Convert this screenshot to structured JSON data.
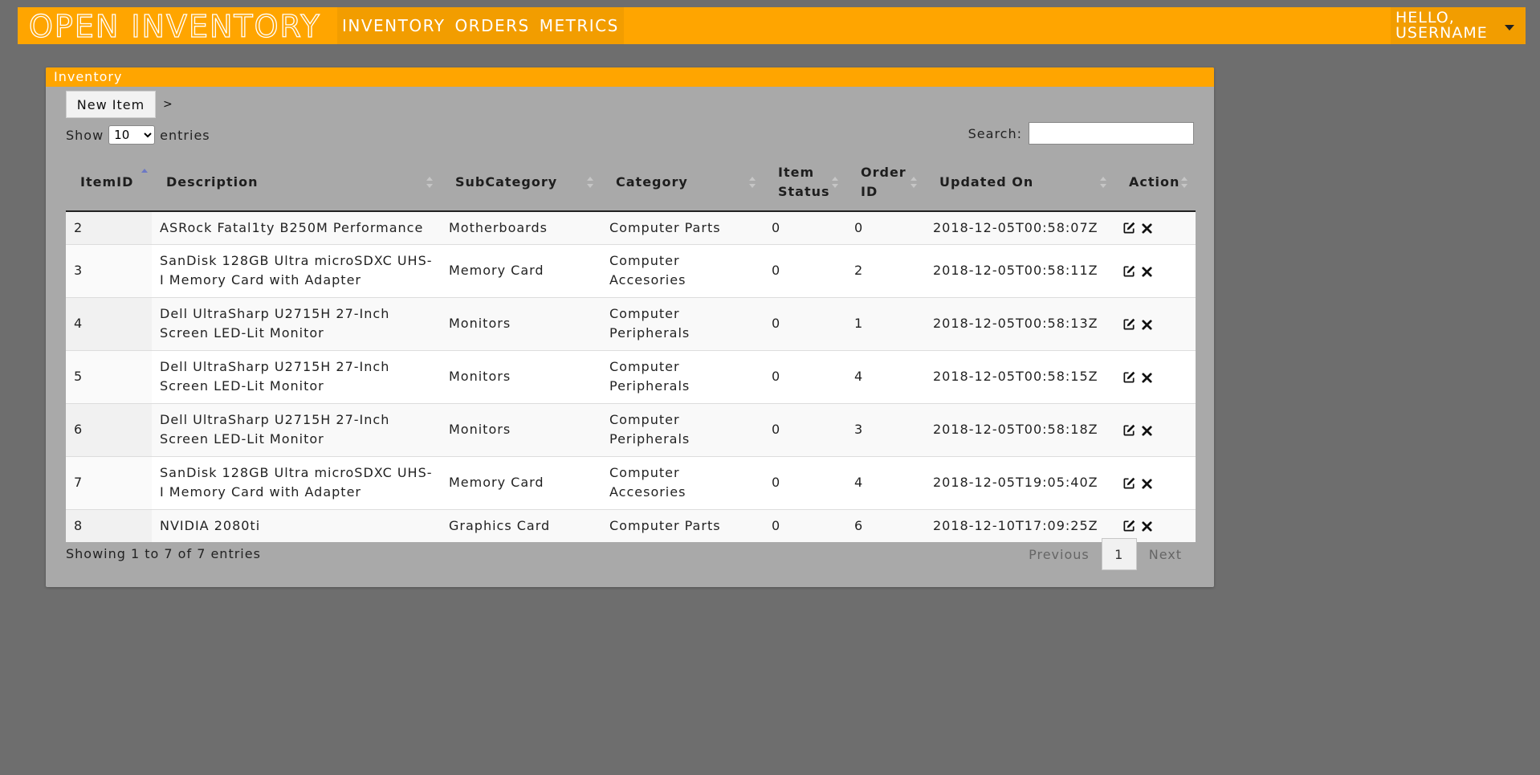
{
  "app": {
    "brand": "OPEN INVENTORY"
  },
  "nav": {
    "links": [
      "INVENTORY",
      "ORDERS",
      "METRICS"
    ]
  },
  "user": {
    "greeting": "HELLO, USERNAME"
  },
  "panel": {
    "title": "Inventory",
    "new_item_label": "New Item",
    "breadcrumb": ">",
    "length": {
      "prefix": "Show",
      "value": "10",
      "suffix": "entries",
      "options": [
        "10"
      ]
    },
    "search": {
      "label": "Search:",
      "value": ""
    }
  },
  "table": {
    "columns": [
      "ItemID",
      "Description",
      "SubCategory",
      "Category",
      "Item Status",
      "Order ID",
      "Updated On",
      "Action"
    ],
    "sort": {
      "column": "ItemID",
      "direction": "asc"
    },
    "rows": [
      {
        "id": "2",
        "description": "ASRock Fatal1ty B250M Performance",
        "subcategory": "Motherboards",
        "category": "Computer Parts",
        "status": "0",
        "order": "0",
        "updated": "2018-12-05T00:58:07Z"
      },
      {
        "id": "3",
        "description": "SanDisk 128GB Ultra microSDXC UHS-I Memory Card with Adapter",
        "subcategory": "Memory Card",
        "category": "Computer Accesories",
        "status": "0",
        "order": "2",
        "updated": "2018-12-05T00:58:11Z"
      },
      {
        "id": "4",
        "description": "Dell UltraSharp U2715H 27-Inch Screen LED-Lit Monitor",
        "subcategory": "Monitors",
        "category": "Computer Peripherals",
        "status": "0",
        "order": "1",
        "updated": "2018-12-05T00:58:13Z"
      },
      {
        "id": "5",
        "description": "Dell UltraSharp U2715H 27-Inch Screen LED-Lit Monitor",
        "subcategory": "Monitors",
        "category": "Computer Peripherals",
        "status": "0",
        "order": "4",
        "updated": "2018-12-05T00:58:15Z"
      },
      {
        "id": "6",
        "description": "Dell UltraSharp U2715H 27-Inch Screen LED-Lit Monitor",
        "subcategory": "Monitors",
        "category": "Computer Peripherals",
        "status": "0",
        "order": "3",
        "updated": "2018-12-05T00:58:18Z"
      },
      {
        "id": "7",
        "description": "SanDisk 128GB Ultra microSDXC UHS-I Memory Card with Adapter",
        "subcategory": "Memory Card",
        "category": "Computer Accesories",
        "status": "0",
        "order": "4",
        "updated": "2018-12-05T19:05:40Z"
      },
      {
        "id": "8",
        "description": "NVIDIA 2080ti",
        "subcategory": "Graphics Card",
        "category": "Computer Parts",
        "status": "0",
        "order": "6",
        "updated": "2018-12-10T17:09:25Z"
      }
    ],
    "row_actions": [
      "edit-icon",
      "delete-icon"
    ]
  },
  "footer": {
    "info": "Showing 1 to 7 of 7 entries",
    "previous": "Previous",
    "current_page": "1",
    "next": "Next"
  },
  "colors": {
    "accent": "#ffa500",
    "background": "#6e6e6e",
    "panel": "#a9a9a9",
    "sort_active": "#6c78c4"
  }
}
